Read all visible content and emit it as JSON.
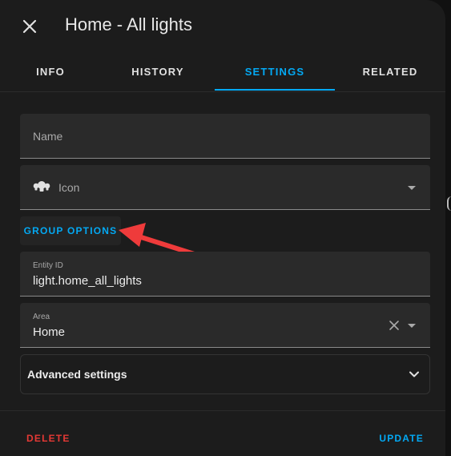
{
  "dialog": {
    "title": "Home - All lights"
  },
  "tabs": [
    {
      "label": "INFO",
      "active": false
    },
    {
      "label": "HISTORY",
      "active": false
    },
    {
      "label": "SETTINGS",
      "active": true
    },
    {
      "label": "RELATED",
      "active": false
    }
  ],
  "form": {
    "name": {
      "placeholder": "Name",
      "value": ""
    },
    "icon": {
      "placeholder": "Icon",
      "icon": "lightbulb-group-icon"
    },
    "group_options_label": "GROUP OPTIONS",
    "entity_id": {
      "label": "Entity ID",
      "value": "light.home_all_lights"
    },
    "area": {
      "label": "Area",
      "value": "Home"
    },
    "advanced_label": "Advanced settings"
  },
  "footer": {
    "delete_label": "DELETE",
    "update_label": "UPDATE"
  },
  "colors": {
    "accent": "#03a9f4",
    "danger": "#e53935",
    "annotation": "#ef3b3b",
    "surface": "#1c1c1c",
    "field": "#2a2a2a"
  }
}
